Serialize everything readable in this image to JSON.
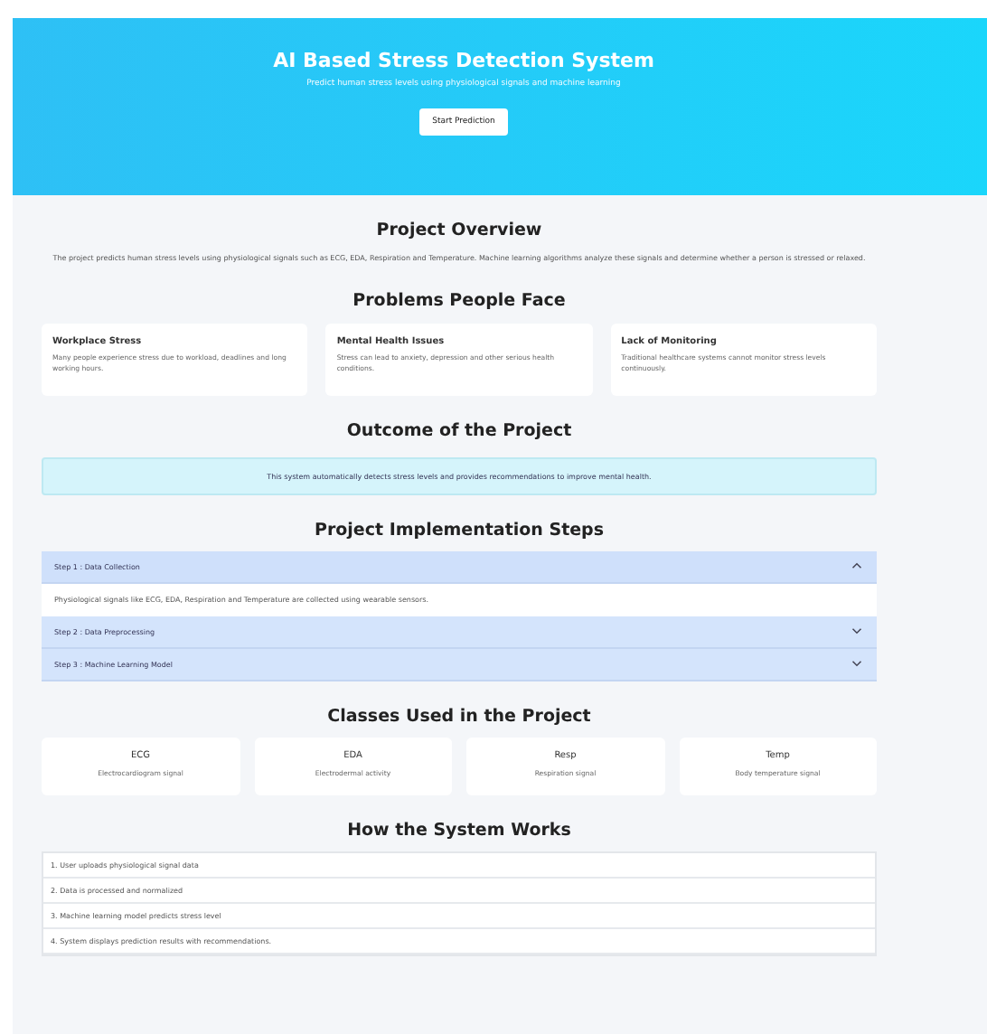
{
  "hero": {
    "title": "AI Based Stress Detection System",
    "subtitle": "Predict human stress levels using physiological signals and machine learning",
    "button": "Start Prediction"
  },
  "overview": {
    "heading": "Project Overview",
    "text": "The project predicts human stress levels using physiological signals such as ECG, EDA, Respiration and Temperature. Machine learning algorithms analyze these signals and determine whether a person is stressed or relaxed."
  },
  "problems": {
    "heading": "Problems People Face",
    "cards": [
      {
        "title": "Workplace Stress",
        "text": "Many people experience stress due to workload, deadlines and long working hours."
      },
      {
        "title": "Mental Health Issues",
        "text": "Stress can lead to anxiety, depression and other serious health conditions."
      },
      {
        "title": "Lack of Monitoring",
        "text": "Traditional healthcare systems cannot monitor stress levels continuously."
      }
    ]
  },
  "outcome": {
    "heading": "Outcome of the Project",
    "text": "This system automatically detects stress levels and provides recommendations to improve mental health."
  },
  "steps": {
    "heading": "Project Implementation Steps",
    "items": [
      {
        "title": "Step 1 : Data Collection",
        "expanded": true,
        "body": "Physiological signals like ECG, EDA, Respiration and Temperature are collected using wearable sensors."
      },
      {
        "title": "Step 2 : Data Preprocessing",
        "expanded": false
      },
      {
        "title": "Step 3 : Machine Learning Model",
        "expanded": false
      }
    ]
  },
  "classes": {
    "heading": "Classes Used in the Project",
    "cards": [
      {
        "name": "ECG",
        "text": "Electrocardiogram signal"
      },
      {
        "name": "EDA",
        "text": "Electrodermal activity"
      },
      {
        "name": "Resp",
        "text": "Respiration signal"
      },
      {
        "name": "Temp",
        "text": "Body temperature signal"
      }
    ]
  },
  "how": {
    "heading": "How the System Works",
    "items": [
      "1. User uploads physiological signal data",
      "2. Data is processed and normalized",
      "3. Machine learning model predicts stress level",
      "4. System displays prediction results with recommendations."
    ]
  }
}
